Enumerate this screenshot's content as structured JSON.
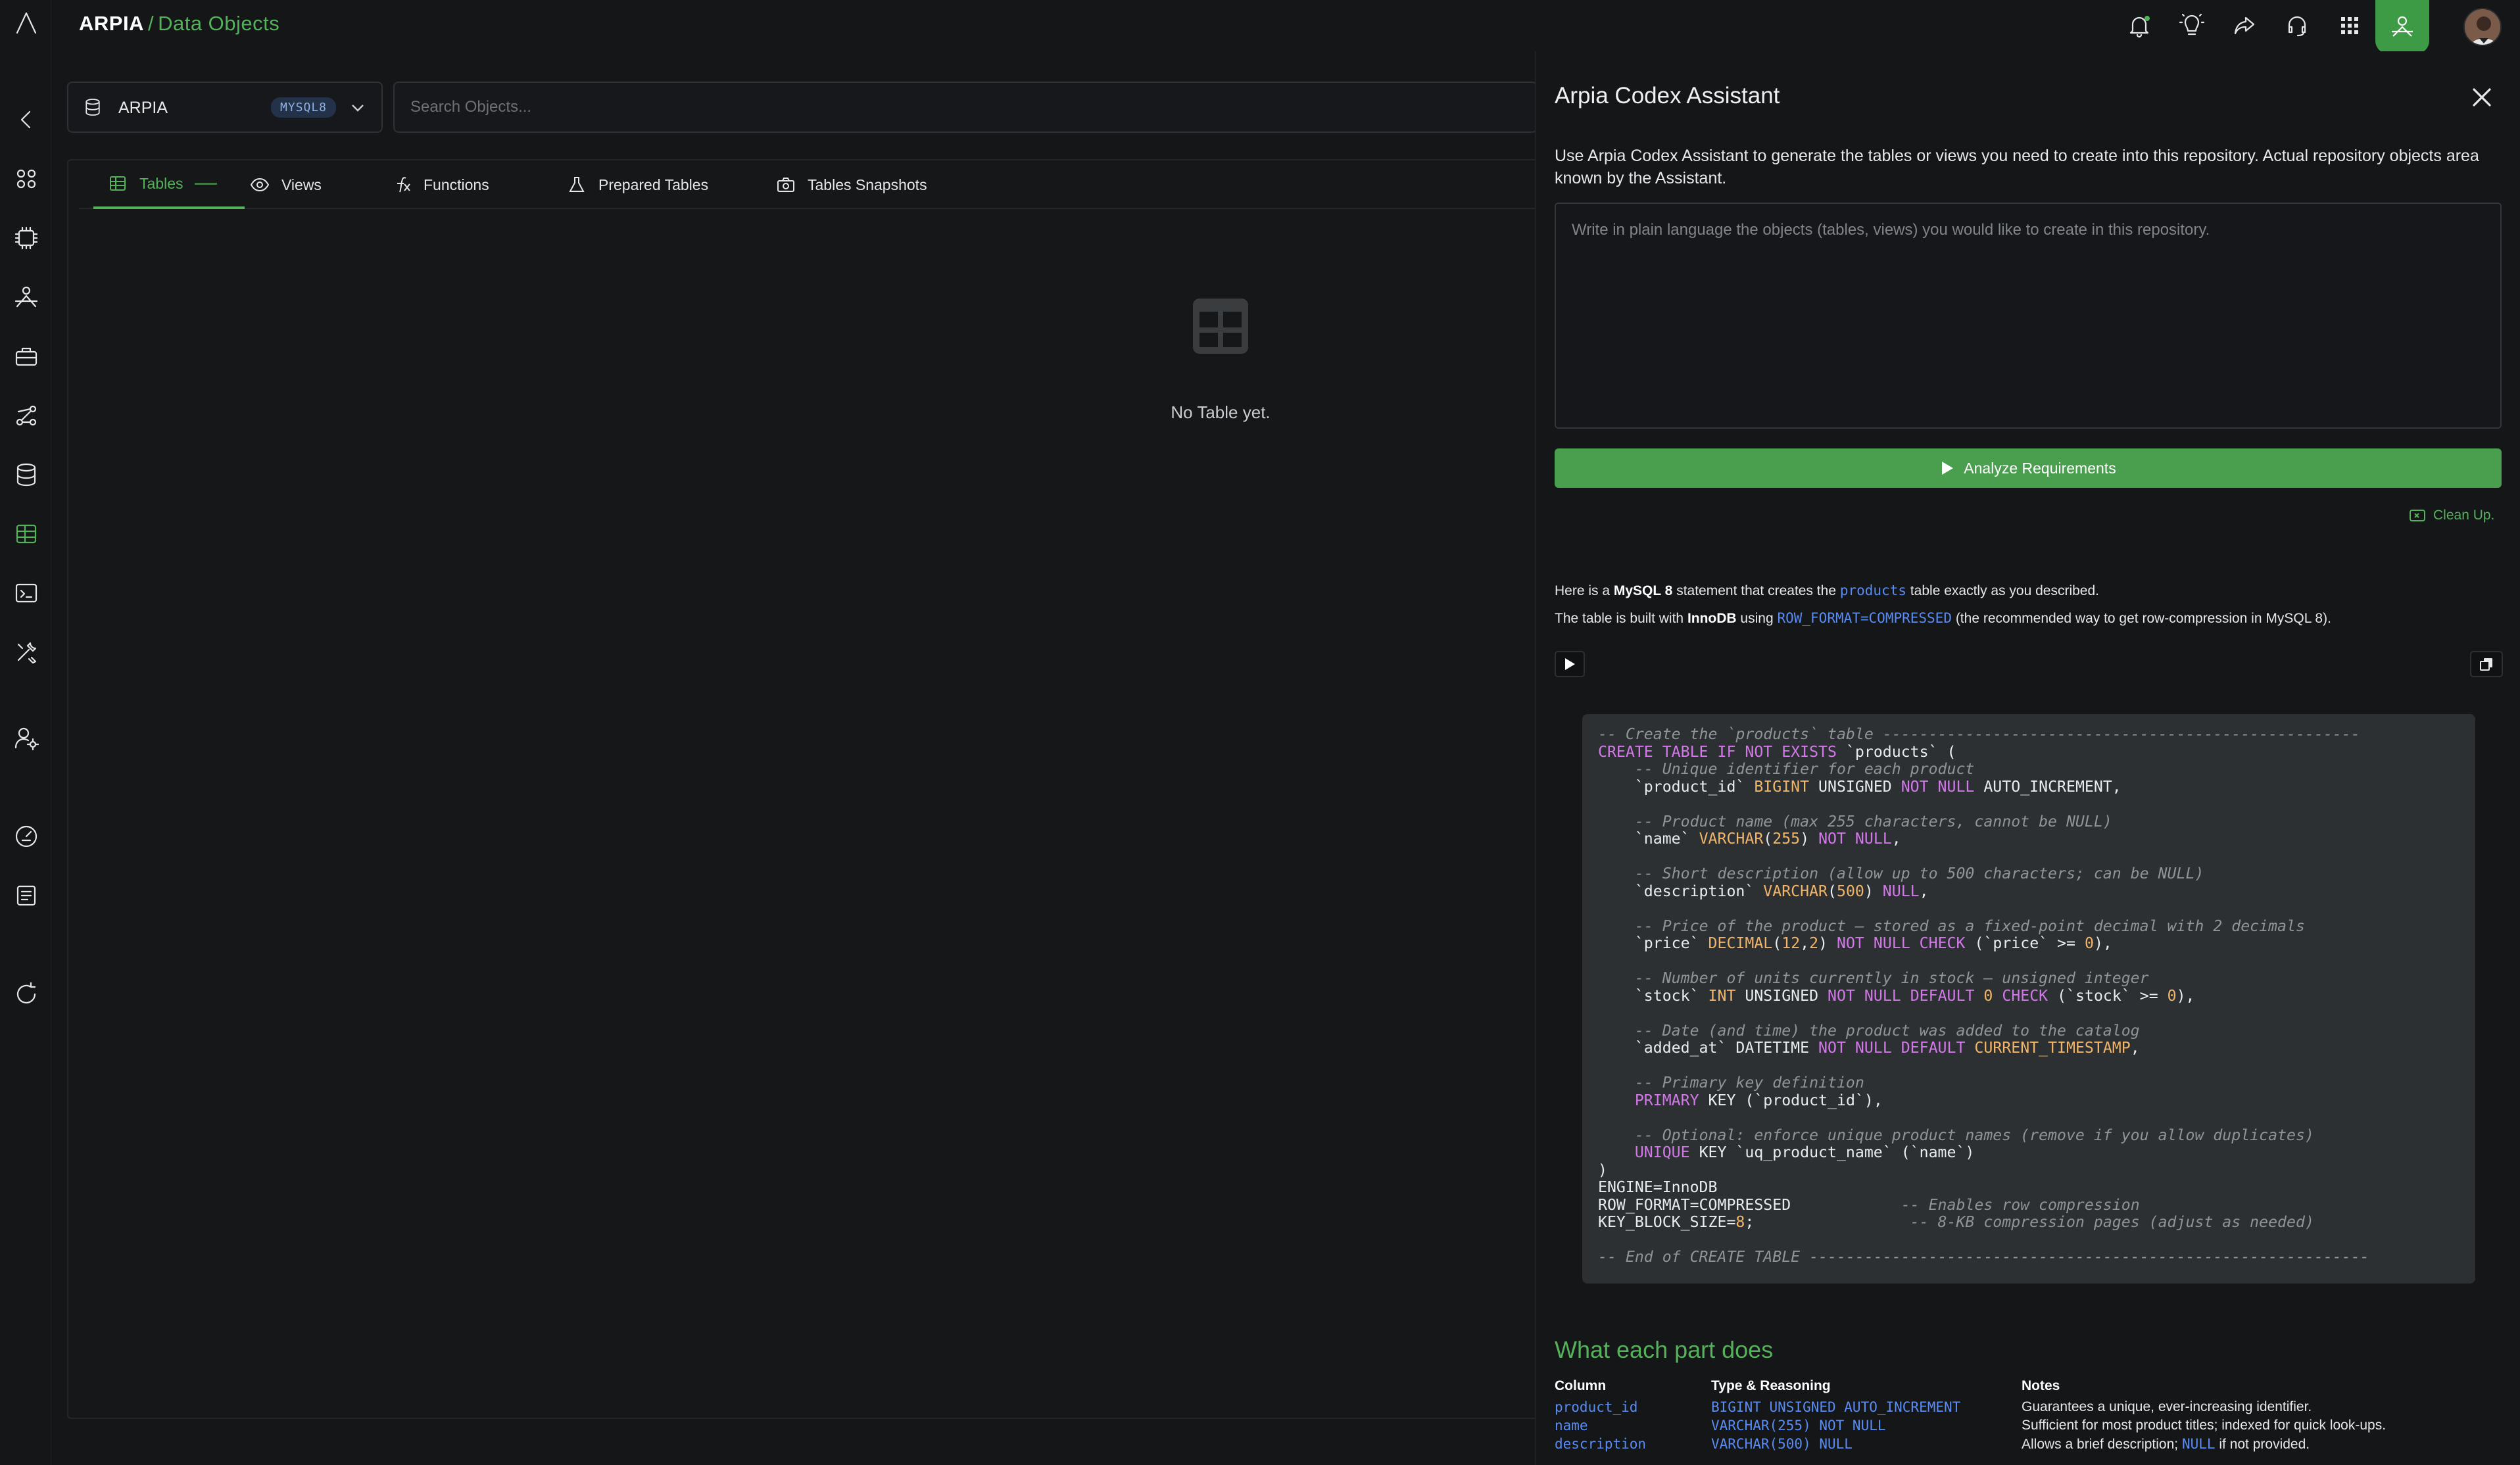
{
  "brand": {
    "name": "ARPIA",
    "separator": "/",
    "page": "Data Objects"
  },
  "repo": {
    "name": "ARPIA",
    "badge": "MYSQL8"
  },
  "search": {
    "placeholder": "Search Objects..."
  },
  "tabs": [
    {
      "label": "Tables",
      "icon": "table-icon",
      "active": true
    },
    {
      "label": "Views",
      "icon": "eye-icon"
    },
    {
      "label": "Functions",
      "icon": "function-icon"
    },
    {
      "label": "Prepared Tables",
      "icon": "flask-icon"
    },
    {
      "label": "Tables Snapshots",
      "icon": "camera-icon"
    }
  ],
  "empty_state": {
    "text": "No Table yet.",
    "icon": "grid-icon"
  },
  "assistant": {
    "title": "Arpia Codex Assistant",
    "description": "Use Arpia Codex Assistant to generate the tables or views you need to create into this repository. Actual repository objects area known by the Assistant.",
    "prompt_placeholder": "Write in plain language the objects (tables, views) you would like to create in this repository.",
    "analyze_label": "Analyze Requirements",
    "cleanup_label": "Clean Up.",
    "response": {
      "line1_pre": "Here is a ",
      "line1_bold": "MySQL 8",
      "line1_mid": " statement that creates the ",
      "line1_code": "products",
      "line1_post": " table exactly as you described.",
      "line2_pre": "The table is built with ",
      "line2_bold": "InnoDB",
      "line2_mid": " using ",
      "line2_code": "ROW_FORMAT=COMPRESSED",
      "line2_post": " (the recommended way to get row-compression in MySQL 8)."
    },
    "parts_title": "What each part does",
    "parts_headers": {
      "column": "Column",
      "type": "Type & Reasoning",
      "notes": "Notes"
    },
    "parts_rows": [
      {
        "column": "product_id",
        "type": "BIGINT UNSIGNED AUTO_INCREMENT",
        "notes": "Guarantees a unique, ever-increasing identifier."
      },
      {
        "column": "name",
        "type": "VARCHAR(255) NOT NULL",
        "notes": "Sufficient for most product titles; indexed for quick look-ups."
      },
      {
        "column": "description",
        "type": "VARCHAR(500) NULL",
        "notes_pre": "Allows a brief description; ",
        "notes_code": "NULL",
        "notes_post": " if not provided."
      }
    ]
  },
  "colors": {
    "accent": "#55b15a",
    "background": "#141618",
    "code_bg": "#2d3033",
    "link": "#5b8cf2"
  }
}
